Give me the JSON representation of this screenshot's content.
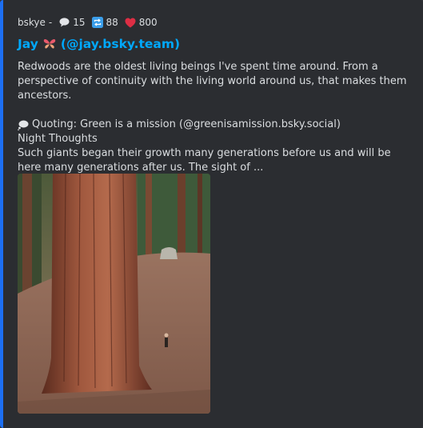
{
  "author": {
    "name": "bskye",
    "separator": "-",
    "replies": "15",
    "reposts": "88",
    "likes": "800"
  },
  "title": {
    "name": "Jay",
    "handle": "(@jay.bsky.team)"
  },
  "post": {
    "text": "Redwoods are the oldest living beings I've spent time around. From a perspective of continuity with the living world around us, that makes them ancestors.",
    "quote_label": "Quoting: Green is a mission (@greenisamission.bsky.social)",
    "quote_title": "Night Thoughts",
    "quote_text": "Such giants began their growth many generations before us and will be here many generations after us. The sight of ..."
  },
  "icons": {
    "replies": "speech-bubble-icon",
    "reposts": "repost-icon",
    "likes": "heart-icon",
    "title_emoji": "butterfly-icon",
    "quote": "thought-bubble-icon"
  },
  "colors": {
    "accent_bar": "#1d6ff2",
    "title_link": "#00a8fc",
    "embed_bg": "#2b2d31"
  }
}
